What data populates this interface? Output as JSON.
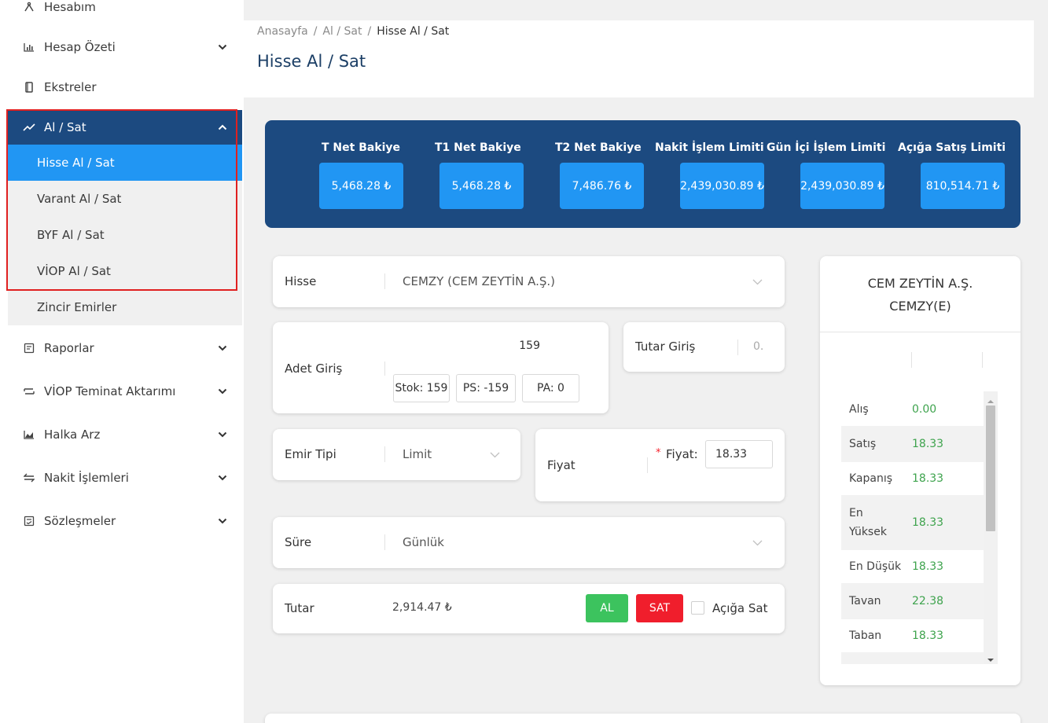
{
  "sidebar": {
    "top_item": "Hesabım",
    "items": [
      {
        "label": "Hesap Özeti"
      },
      {
        "label": "Ekstreler"
      },
      {
        "label": "Al / Sat"
      },
      {
        "label": "Raporlar"
      },
      {
        "label": "VİOP Teminat Aktarımı"
      },
      {
        "label": "Halka Arz"
      },
      {
        "label": "Nakit İşlemleri"
      },
      {
        "label": "Sözleşmeler"
      }
    ],
    "submenu": [
      {
        "label": "Hisse Al / Sat"
      },
      {
        "label": "Varant Al / Sat"
      },
      {
        "label": "BYF Al / Sat"
      },
      {
        "label": "VİOP Al / Sat"
      },
      {
        "label": "Zincir Emirler"
      }
    ]
  },
  "breadcrumb": [
    "Anasayfa",
    "Al / Sat",
    "Hisse Al / Sat"
  ],
  "breadcrumb_sep": "/",
  "page_title": "Hisse Al / Sat",
  "balances": [
    {
      "title": "T Net Bakiye",
      "value": "5,468.28 ₺"
    },
    {
      "title": "T1 Net Bakiye",
      "value": "5,468.28 ₺"
    },
    {
      "title": "T2 Net Bakiye",
      "value": "7,486.76 ₺"
    },
    {
      "title": "Nakit İşlem Limiti",
      "value": "2,439,030.89 ₺"
    },
    {
      "title": "Gün İçi İşlem Limiti",
      "value": "2,439,030.89 ₺"
    },
    {
      "title": "Açığa Satış Limiti",
      "value": "810,514.71 ₺"
    }
  ],
  "form": {
    "hisse_label": "Hisse",
    "hisse_value": "CEMZY (CEM ZEYTİN A.Ş.)",
    "adet_label": "Adet Giriş",
    "adet_value": "159",
    "stok": "Stok: 159",
    "ps": "PS: -159",
    "pa": "PA: 0",
    "tutar_giris_label": "Tutar Giriş",
    "tutar_giris_value": "0.",
    "emir_tipi_label": "Emir Tipi",
    "emir_tipi_value": "Limit",
    "fiyat_label": "Fiyat",
    "fiyat_required": "*",
    "fiyat_field_label": "Fiyat:",
    "fiyat_value": "18.33",
    "sure_label": "Süre",
    "sure_value": "Günlük",
    "tutar_label": "Tutar",
    "tutar_value": "2,914.47 ₺",
    "al_button": "AL",
    "sat_button": "SAT",
    "aciga_sat_label": "Açığa Sat"
  },
  "quote": {
    "title_line1": "CEM ZEYTİN A.Ş.",
    "title_line2": "CEMZY(E)",
    "rows": [
      {
        "k": "Alış",
        "v": "0.00"
      },
      {
        "k": "Satış",
        "v": "18.33"
      },
      {
        "k": "Kapanış",
        "v": "18.33"
      },
      {
        "k": "En Yüksek",
        "v": "18.33"
      },
      {
        "k": "En Düşük",
        "v": "18.33"
      },
      {
        "k": "Tavan",
        "v": "22.38"
      },
      {
        "k": "Taban",
        "v": "18.33"
      }
    ]
  },
  "colors": {
    "primary": "#1c4a80",
    "accent": "#2196f3",
    "buy": "#3cc35e",
    "sell": "#f01e2c",
    "quote_value": "#3ea34d",
    "highlight_border": "#e02020"
  },
  "icons": [
    "user-icon",
    "chart-bar-icon",
    "document-icon",
    "trend-icon",
    "report-icon",
    "swap-icon",
    "area-chart-icon",
    "exchange-icon",
    "contract-icon",
    "chevron-down-icon",
    "chevron-up-icon"
  ]
}
